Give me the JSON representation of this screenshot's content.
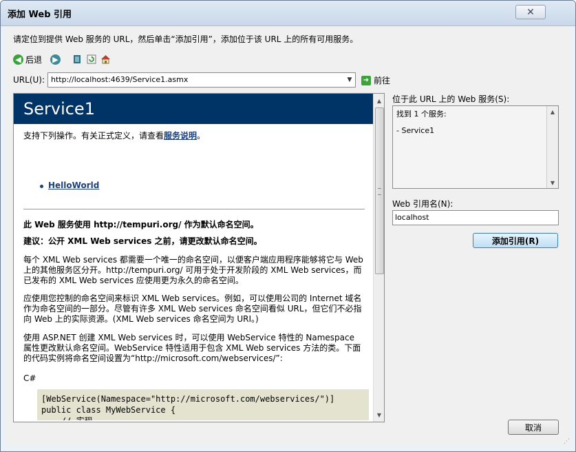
{
  "window": {
    "title": "添加 Web 引用",
    "close_glyph": "✕"
  },
  "instruction": "请定位到提供 Web 服务的 URL，然后单击“添加引用”，添加位于该 URL 上的所有可用服务。",
  "toolbar": {
    "back_label": "后退",
    "icons": [
      "back-icon",
      "forward-icon",
      "stop-icon",
      "refresh-icon",
      "home-icon"
    ]
  },
  "url": {
    "label": "URL(U):",
    "value": "http://localhost:4639/Service1.asmx",
    "go_label": "前往"
  },
  "page": {
    "service_title": "Service1",
    "intro_prefix": "支持下列操作。有关正式定义，请查看",
    "intro_link": "服务说明",
    "intro_suffix": "。",
    "operation": "HelloWorld",
    "ns_heading": "此 Web 服务使用 http://tempuri.org/ 作为默认命名空间。",
    "ns_advice": "建议：公开 XML Web services 之前，请更改默认命名空间。",
    "para1": "每个 XML Web services 都需要一个唯一的命名空间，以便客户端应用程序能够将它与 Web 上的其他服务区分开。http://tempuri.org/ 可用于处于开发阶段的 XML Web services，而已发布的 XML Web services 应使用更为永久的命名空间。",
    "para2": "应使用您控制的命名空间来标识 XML Web services。例如，可以使用公司的 Internet 域名作为命名空间的一部分。尽管有许多 XML Web services 命名空间看似 URL，但它们不必指向 Web 上的实际资源。(XML Web services 命名空间为 URI。)",
    "para3": "使用 ASP.NET 创建 XML Web services 时，可以使用 WebService 特性的 Namespace 属性更改默认命名空间。WebService 特性适用于包含 XML Web services 方法的类。下面的代码实例将命名空间设置为“http://microsoft.com/webservices/”:",
    "lang": "C#",
    "code": "[WebService(Namespace=\"http://microsoft.com/webservices/\")]\npublic class MyWebService {\n    // 实现\n}"
  },
  "services_panel": {
    "label": "位于此 URL 上的 Web 服务(S):",
    "found": "找到 1 个服务:",
    "item": "- Service1"
  },
  "reference": {
    "label": "Web 引用名(N):",
    "value": "localhost"
  },
  "buttons": {
    "add": "添加引用(R)",
    "cancel": "取消"
  },
  "colors": {
    "header_bg": "#003366",
    "link": "#1d3f7a",
    "code_bg": "#e3e3cf"
  }
}
